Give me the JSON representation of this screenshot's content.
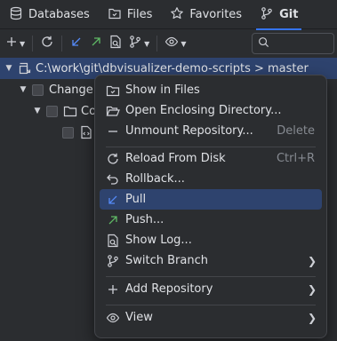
{
  "tabs": [
    {
      "label": "Databases",
      "icon": "database-icon"
    },
    {
      "label": "Files",
      "icon": "files-icon"
    },
    {
      "label": "Favorites",
      "icon": "star-icon"
    },
    {
      "label": "Git",
      "icon": "git-branch-icon",
      "active": true
    }
  ],
  "toolbar": {
    "search_value": ""
  },
  "tree": {
    "repo_label": "C:\\work\\git\\dbvisualizer-demo-scripts > master",
    "changes_label": "Change",
    "child_label": "Co"
  },
  "menu": {
    "items": [
      {
        "label": "Show in Files",
        "icon": "folder-icon",
        "shortcut": ""
      },
      {
        "label": "Open Enclosing Directory...",
        "icon": "folder-open-icon",
        "shortcut": ""
      },
      {
        "label": "Unmount Repository...",
        "icon": "minus-icon",
        "shortcut": "Delete"
      },
      {
        "label": "Reload From Disk",
        "icon": "reload-icon",
        "shortcut": "Ctrl+R"
      },
      {
        "label": "Rollback...",
        "icon": "rollback-icon",
        "shortcut": ""
      },
      {
        "label": "Pull",
        "icon": "pull-arrow-icon",
        "shortcut": "",
        "highlighted": true
      },
      {
        "label": "Push...",
        "icon": "push-arrow-icon",
        "shortcut": ""
      },
      {
        "label": "Show Log...",
        "icon": "log-icon",
        "shortcut": ""
      },
      {
        "label": "Switch Branch",
        "icon": "branch-icon",
        "shortcut": "",
        "submenu": true
      },
      {
        "label": "Add Repository",
        "icon": "plus-icon",
        "shortcut": "",
        "submenu": true
      },
      {
        "label": "View",
        "icon": "eye-icon",
        "shortcut": "",
        "submenu": true
      }
    ]
  },
  "colors": {
    "background": "#2b2d30",
    "selection": "#2e436e",
    "accent": "#3574f0",
    "pull_arrow": "#548af7",
    "push_arrow": "#5fb865"
  }
}
